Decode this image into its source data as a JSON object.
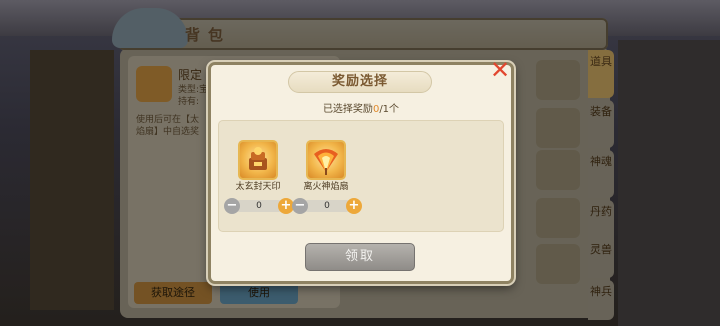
{
  "background": {
    "bag_title": "背包",
    "item_detail": {
      "name": "限定",
      "meta": "类型:宝\n持有:",
      "description": "使用后可在【太\n焰扇】中自选奖"
    },
    "buttons": {
      "get_way": "获取途径",
      "use": "使用"
    },
    "side_tabs": [
      "道具",
      "装备",
      "神魂",
      "丹药",
      "灵兽",
      "神兵"
    ]
  },
  "dialog": {
    "title": "奖励选择",
    "selected_prefix": "已选择奖励",
    "selected_count": "0",
    "selected_suffix": "/1个",
    "rewards": [
      {
        "name": "太玄封天印",
        "value": "0",
        "icon": "treasure-seal-icon"
      },
      {
        "name": "离火神焰扇",
        "value": "0",
        "icon": "flame-fan-icon"
      }
    ],
    "claim_label": "领取",
    "close_icon": "close-icon"
  },
  "colors": {
    "accent_orange": "#eda83a",
    "close_red": "#e2472f",
    "claim_gray": "#a09d99"
  }
}
